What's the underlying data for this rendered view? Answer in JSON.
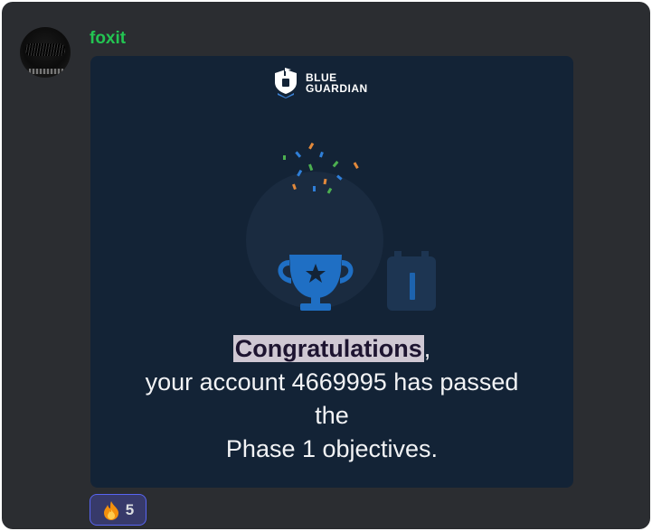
{
  "message": {
    "author": "foxit",
    "author_color": "#23c552"
  },
  "card": {
    "brand_line1": "BLUE",
    "brand_line2": "GUARDIAN",
    "headline": "Congratulations",
    "headline_punct": ",",
    "body_line1": "your account 4669995 has passed",
    "body_line2": "the",
    "body_line3": "Phase 1 objectives.",
    "trophy_icon": "trophy-icon",
    "background_color": "#132336",
    "trophy_color": "#1f6fc4"
  },
  "reactions": [
    {
      "emoji": "🔥",
      "icon": "fire-icon",
      "count": "5"
    }
  ]
}
